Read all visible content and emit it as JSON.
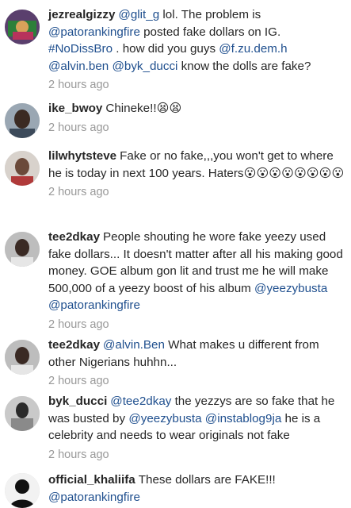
{
  "comments": [
    {
      "username": "jezrealgizzy",
      "parts": [
        {
          "t": "m",
          "v": "@glit_g"
        },
        {
          "t": "s",
          "v": " lol. The problem is "
        },
        {
          "t": "m",
          "v": "@patorankingfire"
        },
        {
          "t": "s",
          "v": " posted fake dollars on IG. "
        },
        {
          "t": "m",
          "v": "#NoDissBro"
        },
        {
          "t": "s",
          "v": " . how did you guys "
        },
        {
          "t": "m",
          "v": "@f.zu.dem.h"
        },
        {
          "t": "s",
          "v": " "
        },
        {
          "t": "m",
          "v": "@alvin.ben"
        },
        {
          "t": "s",
          "v": " "
        },
        {
          "t": "m",
          "v": "@byk_ducci"
        },
        {
          "t": "s",
          "v": " know the dolls  are fake?"
        }
      ],
      "time": "2 hours ago"
    },
    {
      "username": "ike_bwoy",
      "parts": [
        {
          "t": "s",
          "v": "Chineke!!😫😫"
        }
      ],
      "time": "2 hours ago"
    },
    {
      "username": "lilwhytsteve",
      "parts": [
        {
          "t": "s",
          "v": "Fake or no fake,,,you won't get to where he is today in next 100 years. Haters😮😮😮😮😮😮😮😮"
        }
      ],
      "time": "2 hours ago"
    },
    {
      "username": "tee2dkay",
      "parts": [
        {
          "t": "s",
          "v": "People shouting he wore fake yeezy used fake dollars... It doesn't matter after all his making good money. GOE album gon lit and trust me he will make 500,000 of a yeezy boost of his album "
        },
        {
          "t": "m",
          "v": "@yeezybusta"
        },
        {
          "t": "s",
          "v": " "
        },
        {
          "t": "m",
          "v": "@patorankingfire"
        }
      ],
      "time": "2 hours ago"
    },
    {
      "username": "tee2dkay",
      "parts": [
        {
          "t": "m",
          "v": "@alvin.Ben"
        },
        {
          "t": "s",
          "v": " What makes u different from other Nigerians huhhn..."
        }
      ],
      "time": "2 hours ago"
    },
    {
      "username": "byk_ducci",
      "parts": [
        {
          "t": "m",
          "v": "@tee2dkay"
        },
        {
          "t": "s",
          "v": " the yezzys are so fake that he was busted by "
        },
        {
          "t": "m",
          "v": "@yeezybusta"
        },
        {
          "t": "s",
          "v": " "
        },
        {
          "t": "m",
          "v": "@instablog9ja"
        },
        {
          "t": "s",
          "v": " he is a celebrity and needs to wear originals not fake"
        }
      ],
      "time": "2 hours ago"
    },
    {
      "username": "official_khaliifa",
      "parts": [
        {
          "t": "s",
          "v": "These dollars are FAKE!!! "
        },
        {
          "t": "m",
          "v": "@patorankingfire"
        }
      ],
      "time": ""
    }
  ],
  "colors": {
    "mention": "#1f4f8e",
    "text": "#262626",
    "time": "#999999"
  }
}
